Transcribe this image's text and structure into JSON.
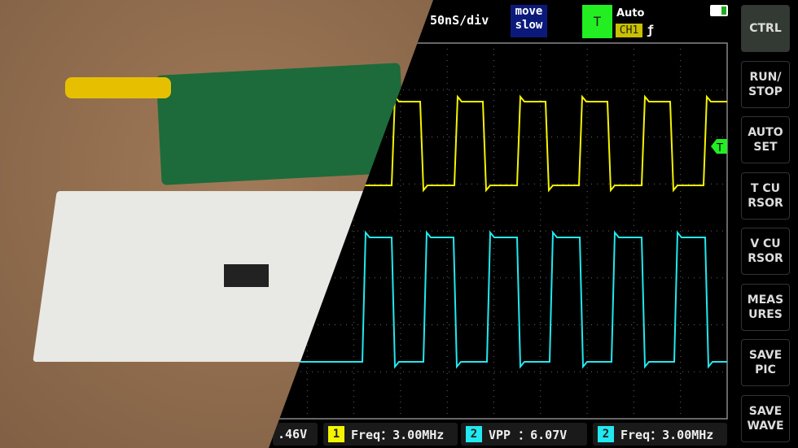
{
  "header": {
    "timebase": "50nS/div",
    "move_mode": "move\nslow",
    "trigger_label": "T",
    "trigger_mode": "Auto",
    "trigger_source": "CH1",
    "trigger_edge_icon": "rising-edge-icon",
    "battery_icon": "battery-icon"
  },
  "channels": {
    "ch1_color": "#f4f400",
    "ch2_color": "#22e8f0",
    "trigger_marker": "T"
  },
  "sidebar": {
    "buttons": [
      {
        "label": "CTRL"
      },
      {
        "label": "RUN/\nSTOP"
      },
      {
        "label": "AUTO\nSET"
      },
      {
        "label": "T CU\nRSOR"
      },
      {
        "label": "V CU\nRSOR"
      },
      {
        "label": "MEAS\nURES"
      },
      {
        "label": "SAVE\nPIC"
      },
      {
        "label": "SAVE\nWAVE"
      }
    ]
  },
  "measurements": [
    {
      "channel": "",
      "text": ".46V"
    },
    {
      "channel": "1",
      "text": "Freq：3.00MHz"
    },
    {
      "channel": "2",
      "text": "VPP ：6.07V"
    },
    {
      "channel": "2",
      "text": "Freq：3.00MHz"
    }
  ]
}
